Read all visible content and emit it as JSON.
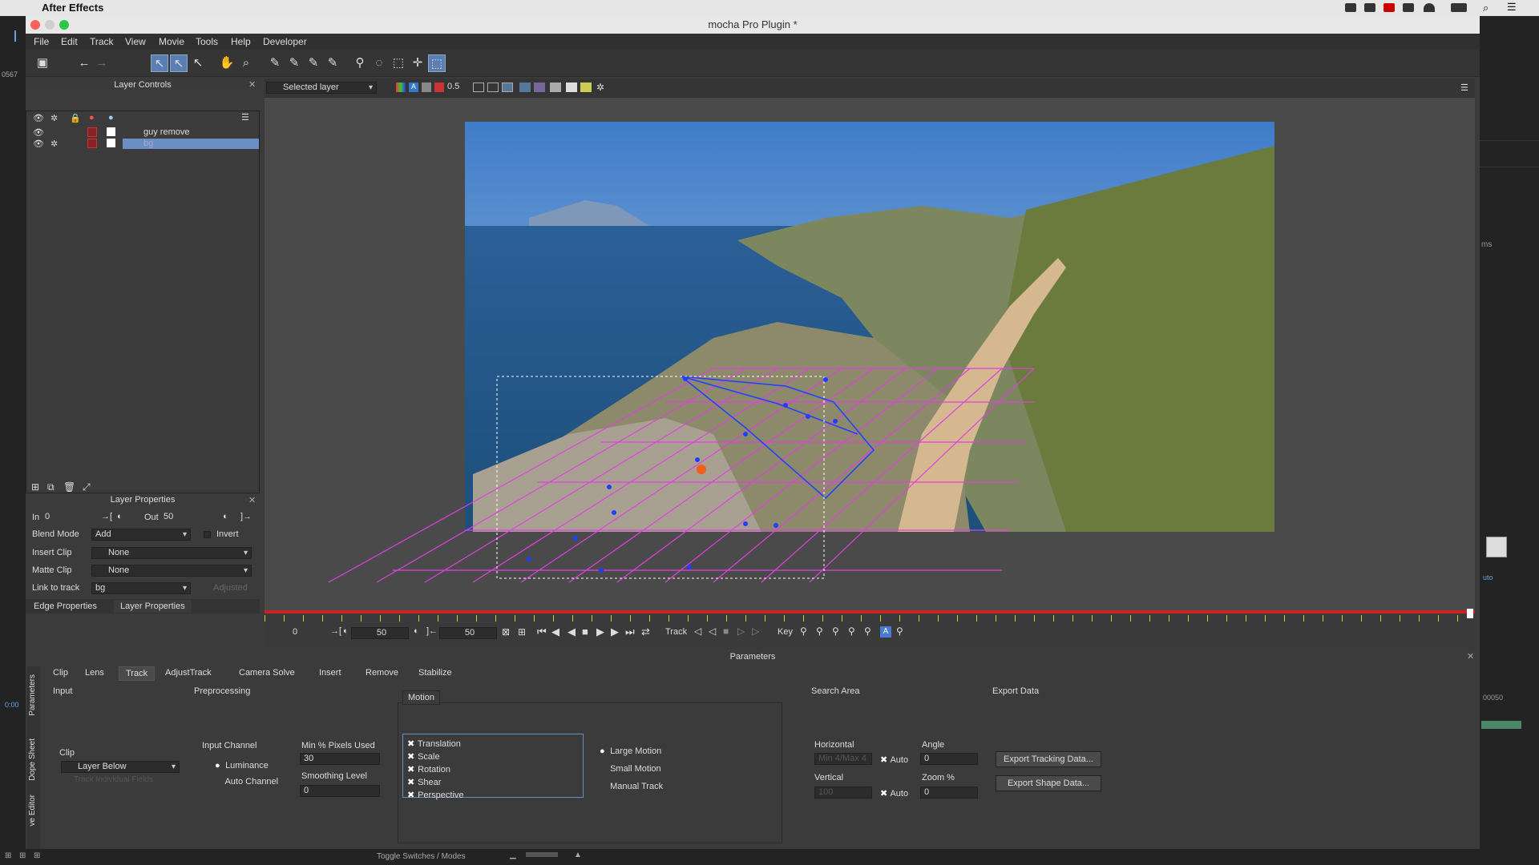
{
  "mac_menu": {
    "app_name": "After Effects"
  },
  "window": {
    "title": "mocha Pro Plugin *"
  },
  "menu": [
    "File",
    "Edit",
    "Track",
    "View",
    "Movie",
    "Tools",
    "Help",
    "Developer"
  ],
  "layer_controls": {
    "title": "Layer Controls",
    "layers": [
      {
        "name": "guy remove"
      },
      {
        "name": "bg"
      }
    ]
  },
  "viewer_toolbar": {
    "layer_select": "Selected layer",
    "opacity": "0.5"
  },
  "layer_properties": {
    "title": "Layer Properties",
    "in_label": "In",
    "in_value": "0",
    "out_label": "Out",
    "out_value": "50",
    "blend_mode_label": "Blend Mode",
    "blend_mode_value": "Add",
    "invert_label": "Invert",
    "insert_clip_label": "Insert Clip",
    "insert_clip_value": "None",
    "matte_clip_label": "Matte Clip",
    "matte_clip_value": "None",
    "link_label": "Link to track",
    "link_value": "bg",
    "adjusted_label": "Adjusted",
    "tab_edge": "Edge Properties",
    "tab_layer": "Layer Properties"
  },
  "timeline": {
    "start": "0",
    "current": "50",
    "end": "50",
    "track_label": "Track",
    "key_label": "Key"
  },
  "parameters": {
    "title": "Parameters",
    "side_tabs": [
      "Parameters",
      "Dope Sheet",
      "ve Editor"
    ],
    "tabs": [
      "Clip",
      "Lens",
      "Track",
      "AdjustTrack",
      "Camera Solve",
      "Insert",
      "Remove",
      "Stabilize"
    ],
    "active_tab": "Track",
    "input": {
      "title": "Input",
      "clip_label": "Clip",
      "clip_value": "Layer Below",
      "track_individual": "Track Individual Fields"
    },
    "preprocessing": {
      "title": "Preprocessing",
      "input_channel_label": "Input Channel",
      "luminance": "Luminance",
      "auto_channel": "Auto Channel",
      "min_pixels_label": "Min % Pixels Used",
      "min_pixels_value": "30",
      "smoothing_label": "Smoothing Level",
      "smoothing_value": "0"
    },
    "motion": {
      "title": "Motion",
      "options": [
        "Translation",
        "Scale",
        "Rotation",
        "Shear",
        "Perspective"
      ],
      "modes": [
        "Large Motion",
        "Small Motion",
        "Manual Track"
      ]
    },
    "search_area": {
      "title": "Search Area",
      "horizontal_label": "Horizontal",
      "horizontal_value": "Min 4/Max 4",
      "vertical_label": "Vertical",
      "vertical_value": "100",
      "auto_label": "Auto",
      "angle_label": "Angle",
      "angle_value": "0",
      "zoom_label": "Zoom %",
      "zoom_value": "0"
    },
    "export_data": {
      "title": "Export Data",
      "tracking_button": "Export Tracking Data...",
      "shape_button": "Export Shape Data..."
    }
  },
  "status": {
    "toggle": "Toggle Switches / Modes"
  },
  "ae_sidebar": {
    "frame_left": "0567",
    "time_left": "0:00",
    "right_label": "ms",
    "right_frame": "00050",
    "right_auto": "uto"
  }
}
